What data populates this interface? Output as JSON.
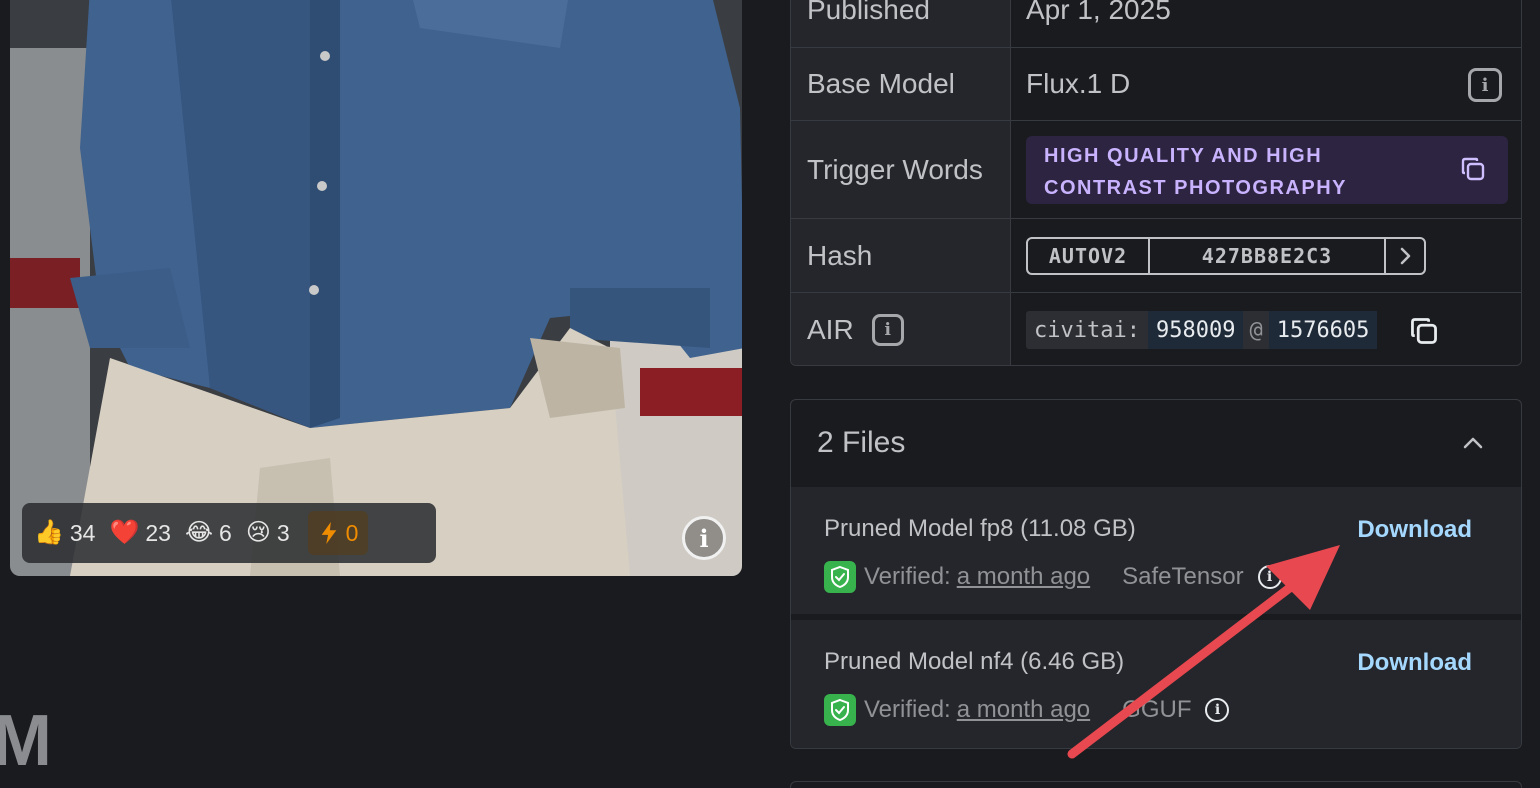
{
  "image_card": {
    "reactions": [
      {
        "emoji": "👍",
        "count": "34",
        "icon": "thumbs-up-icon"
      },
      {
        "emoji": "❤️",
        "count": "23",
        "icon": "heart-icon"
      },
      {
        "emoji": "😂",
        "count": "6",
        "icon": "laugh-icon"
      },
      {
        "emoji": "😢",
        "count": "3",
        "icon": "cry-icon"
      }
    ],
    "tip_count": "0",
    "partial_text": "M"
  },
  "details": {
    "published_label": "Published",
    "published_value": "Apr 1, 2025",
    "base_model_label": "Base Model",
    "base_model_value": "Flux.1 D",
    "trigger_words_label": "Trigger Words",
    "trigger_words": "HIGH QUALITY AND HIGH CONTRAST PHOTOGRAPHY",
    "hash_label": "Hash",
    "hash_type": "AUTOV2",
    "hash_value": "427BB8E2C3",
    "air_label": "AIR",
    "air_prefix": "civitai:",
    "air_model_id": "958009",
    "air_at": "@",
    "air_version_id": "1576605"
  },
  "files": {
    "title": "2 Files",
    "items": [
      {
        "name": "Pruned Model fp8 (11.08 GB)",
        "download": "Download",
        "verified_label": "Verified:",
        "verified_date": "a month ago",
        "format": "SafeTensor"
      },
      {
        "name": "Pruned Model nf4 (6.46 GB)",
        "download": "Download",
        "verified_label": "Verified:",
        "verified_date": "a month ago",
        "format": "GGUF"
      }
    ]
  },
  "colors": {
    "background": "#1a1b1e",
    "link": "#a5d8ff",
    "trigger_badge": "#2c2440",
    "verified_green": "#37b24d",
    "annotation_arrow": "#e8484f"
  }
}
